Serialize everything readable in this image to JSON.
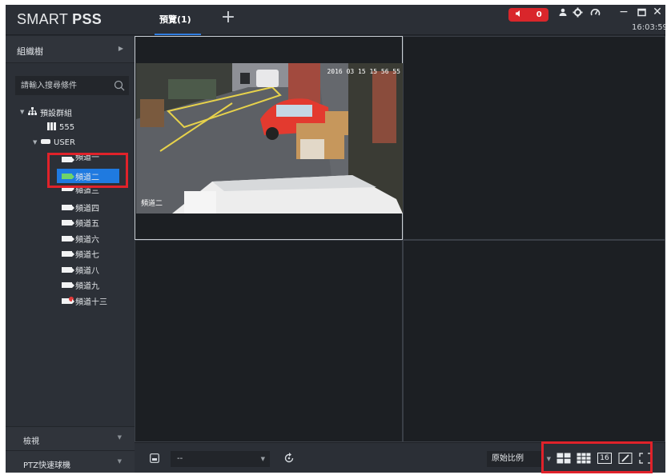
{
  "app": {
    "brand_regular": "SMART ",
    "brand_bold": "PSS",
    "active_tab": "預覽(1)",
    "add_tab_icon": "plus-icon",
    "alarm_count": "0",
    "clock": "16:03:59",
    "accent_color": "#2f7de1",
    "alarm_color": "#d9262b",
    "highlight_color": "#e0222a"
  },
  "left": {
    "panel_title": "組織樹",
    "search_placeholder": "請輸入搜尋條件",
    "tree": {
      "root": "預設群組",
      "group_555": "555",
      "user_group": "USER",
      "channels": [
        "頻道一",
        "頻道二",
        "頻道三",
        "頻道四",
        "頻道五",
        "頻道六",
        "頻道七",
        "頻道八",
        "頻道九",
        "頻道十三"
      ]
    },
    "selected_channel": "頻道二",
    "bottom_panels": [
      "檢視",
      "PTZ快速球機"
    ]
  },
  "video": {
    "timestamp": "2016 03 15 15 56 55",
    "channel_label": "頻道二"
  },
  "toolbar": {
    "preset_value": "--",
    "ratio_value": "原始比例",
    "layout_16_label": "16"
  }
}
